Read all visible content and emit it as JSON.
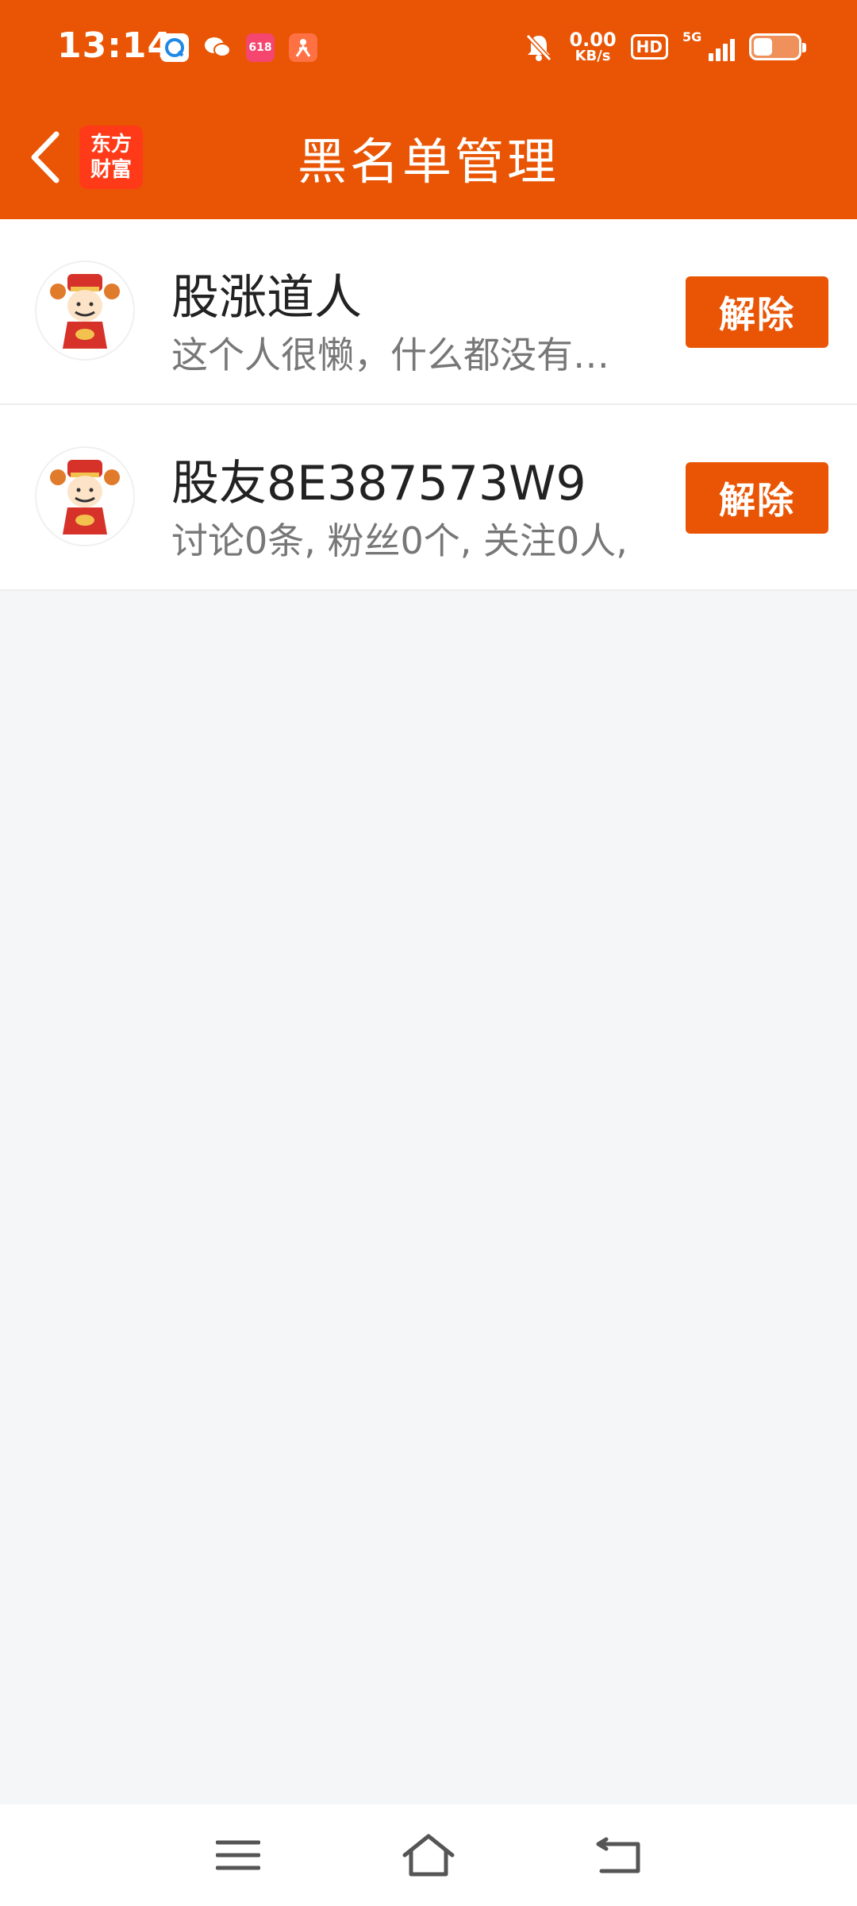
{
  "status_bar": {
    "time": "13:14",
    "app_icons": [
      "browser-icon",
      "wechat-icon",
      "promo-618-icon",
      "runner-app-icon"
    ],
    "promo_label": "618",
    "net_speed_value": "0.00",
    "net_speed_unit": "KB/s",
    "hd_label": "HD",
    "network_label": "5G",
    "battery_level": 0.42
  },
  "header": {
    "app_logo_line1": "东方",
    "app_logo_line2": "财富",
    "title": "黑名单管理",
    "background_color": "#e95504"
  },
  "blacklist": [
    {
      "name": "股涨道人",
      "desc": "这个人很懒，什么都没有…",
      "action_label": "解除"
    },
    {
      "name": "股友8E387573W9",
      "desc": "讨论0条, 粉丝0个, 关注0人,",
      "action_label": "解除"
    }
  ],
  "nav_bar": {
    "icons": [
      "menu-icon",
      "home-icon",
      "back-icon"
    ]
  }
}
